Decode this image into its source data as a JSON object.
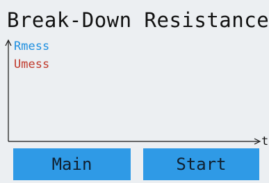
{
  "screen": {
    "title": "Break-Down Resistance"
  },
  "plot": {
    "x_axis_label": "t",
    "legend": [
      {
        "label": "Rmess",
        "color": "#1e8fe0"
      },
      {
        "label": "Umess",
        "color": "#c0392b"
      }
    ],
    "axis_color": "#111111"
  },
  "buttons": {
    "main_label": "Main",
    "start_label": "Start",
    "color": "#2f9ae6"
  }
}
